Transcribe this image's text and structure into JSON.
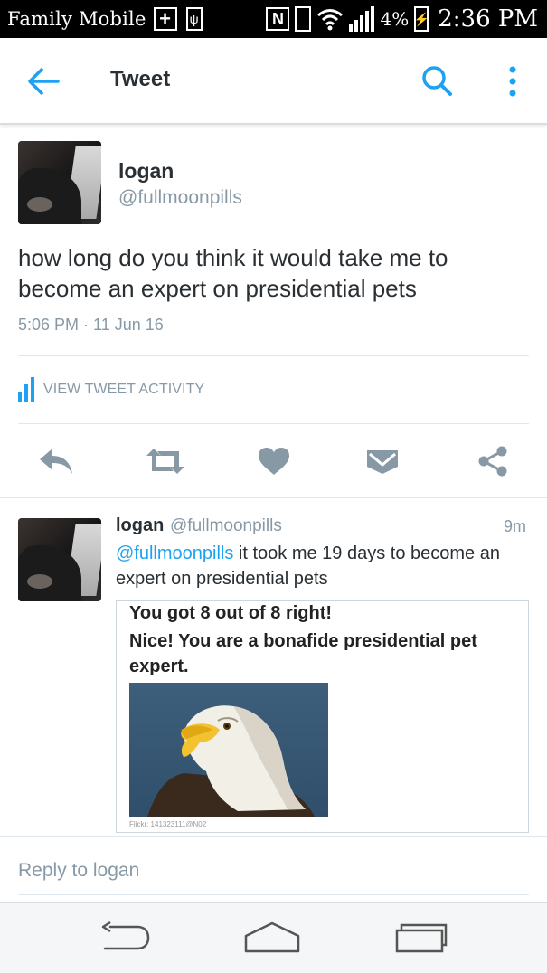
{
  "status_bar": {
    "carrier": "Family Mobile",
    "battery_percent": "4%",
    "time": "2:36 PM",
    "icons": [
      "plus-icon",
      "usb-icon",
      "nfc-icon",
      "vibrate-icon",
      "wifi-icon",
      "signal-icon",
      "battery-charging-icon"
    ]
  },
  "app_bar": {
    "title": "Tweet",
    "icons": [
      "back-arrow-icon",
      "search-icon",
      "more-vertical-icon"
    ]
  },
  "tweet": {
    "name": "logan",
    "handle": "@fullmoonpills",
    "text": "how long do you think it would take me to become an expert on presidential pets",
    "timestamp": "5:06 PM · 11 Jun 16",
    "activity_label": "VIEW TWEET ACTIVITY",
    "actions": [
      "reply-icon",
      "retweet-icon",
      "like-icon",
      "message-icon",
      "share-icon"
    ]
  },
  "reply": {
    "name": "logan",
    "handle": "@fullmoonpills",
    "age": "9m",
    "mention": "@fullmoonpills",
    "text": " it took me 19 days to become an expert on presidential pets",
    "card": {
      "line1": "You got 8 out of 8 right!",
      "line2": "Nice! You are a bonafide presidential pet expert.",
      "image": "bald-eagle-photo",
      "credit": "Flickr: 141323111@N02"
    }
  },
  "reply_box": {
    "placeholder": "Reply to logan"
  },
  "nav_bar": {
    "icons": [
      "back-nav-icon",
      "home-nav-icon",
      "recents-nav-icon"
    ]
  },
  "colors": {
    "accent": "#1da1f2",
    "secondary_text": "#8899a6",
    "icon_gray": "#8899a6"
  }
}
